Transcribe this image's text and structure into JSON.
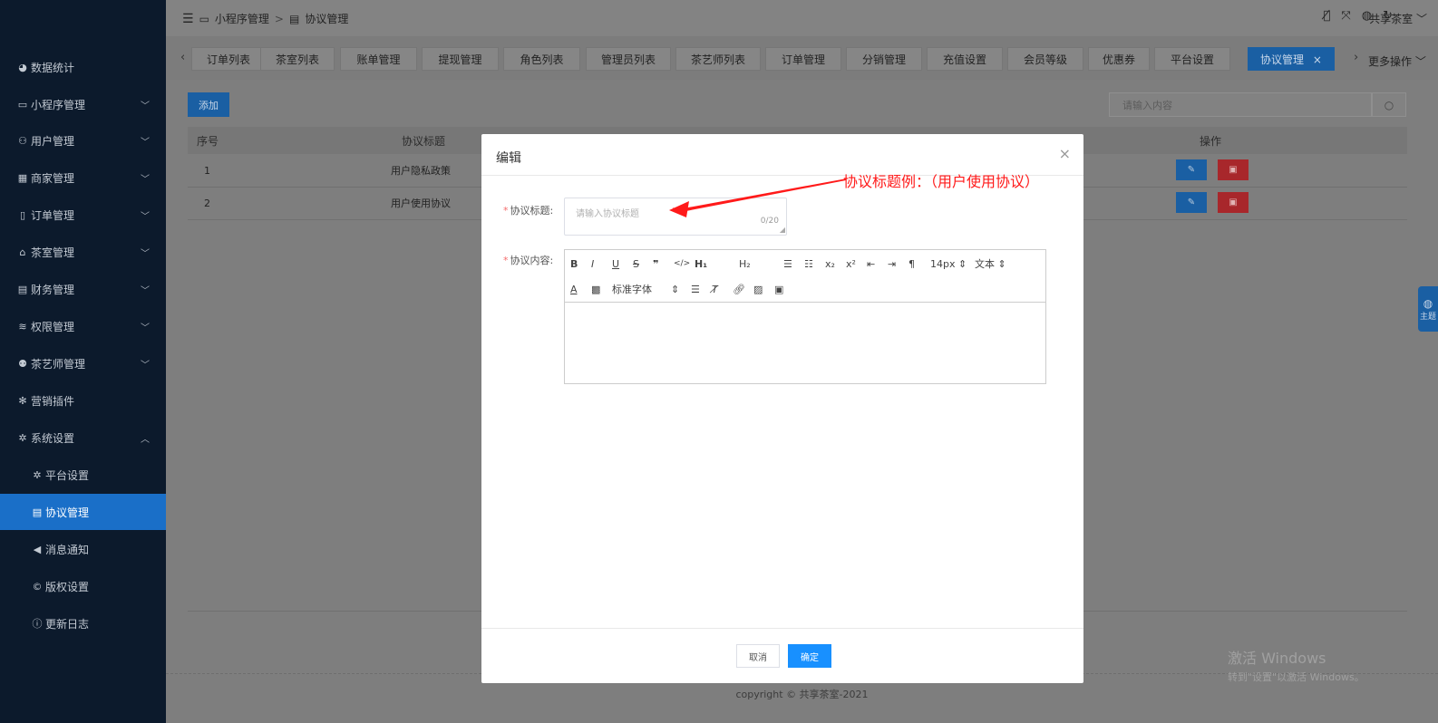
{
  "sidebar": {
    "items": [
      {
        "label": "数据统计",
        "icon": "dashboard-icon",
        "chevron": ""
      },
      {
        "label": "小程序管理",
        "icon": "monitor-icon",
        "chevron": "down"
      },
      {
        "label": "用户管理",
        "icon": "users-icon",
        "chevron": "down"
      },
      {
        "label": "商家管理",
        "icon": "store-icon",
        "chevron": "down"
      },
      {
        "label": "订单管理",
        "icon": "clipboard-icon",
        "chevron": "down"
      },
      {
        "label": "茶室管理",
        "icon": "home-icon",
        "chevron": "down"
      },
      {
        "label": "财务管理",
        "icon": "ledger-icon",
        "chevron": "down"
      },
      {
        "label": "权限管理",
        "icon": "database-icon",
        "chevron": "down"
      },
      {
        "label": "茶艺师管理",
        "icon": "user-cog-icon",
        "chevron": "down"
      },
      {
        "label": "营销插件",
        "icon": "gear-icon",
        "chevron": ""
      },
      {
        "label": "系统设置",
        "icon": "settings-icon",
        "chevron": "up"
      }
    ],
    "subitems": [
      {
        "label": "平台设置",
        "icon": "gear-icon"
      },
      {
        "label": "协议管理",
        "icon": "document-icon",
        "active": true
      },
      {
        "label": "消息通知",
        "icon": "megaphone-icon"
      },
      {
        "label": "版权设置",
        "icon": "copyright-icon"
      },
      {
        "label": "更新日志",
        "icon": "info-circle-icon"
      }
    ]
  },
  "topbar": {
    "breadcrumb": [
      "小程序管理",
      "协议管理"
    ],
    "separator": ">",
    "user": "共享茶室"
  },
  "tabs": {
    "items": [
      "订单列表",
      "茶室列表",
      "账单管理",
      "提现管理",
      "角色列表",
      "管理员列表",
      "茶艺师列表",
      "订单管理",
      "分销管理",
      "充值设置",
      "会员等级",
      "优惠券",
      "平台设置",
      "协议管理"
    ],
    "active": "协议管理",
    "close": "×",
    "more": "更多操作",
    "scroll_left": "‹",
    "scroll_right": "›"
  },
  "toolbar": {
    "add_label": "添加",
    "search_placeholder": "请输入内容"
  },
  "table": {
    "headers": {
      "index": "序号",
      "title": "协议标题",
      "actions": "操作"
    },
    "rows": [
      {
        "index": "1",
        "title": "用户隐私政策"
      },
      {
        "index": "2",
        "title": "用户使用协议"
      }
    ]
  },
  "footer": {
    "copyright": "copyright © 共享茶室-2021"
  },
  "theme_button": {
    "label": "主题"
  },
  "watermark": {
    "line1": "激活 Windows",
    "line2": "转到\"设置\"以激活 Windows。"
  },
  "modal": {
    "title": "编辑",
    "close": "×",
    "title_field": {
      "label": "协议标题:",
      "placeholder": "请输入协议标题",
      "count": "0/20"
    },
    "content_field": {
      "label": "协议内容:"
    },
    "editor": {
      "font_size": "14px",
      "format": "文本",
      "font_family": "标准字体"
    },
    "cancel_label": "取消",
    "ok_label": "确定"
  },
  "annotation": {
    "text": "协议标题例：（用户使用协议）",
    "color": "#ff1a1a"
  },
  "colors": {
    "sidebar_bg": "#0c1a2c",
    "accent": "#1a6fc8",
    "primary_button": "#1890ff",
    "danger": "#a8272b"
  }
}
